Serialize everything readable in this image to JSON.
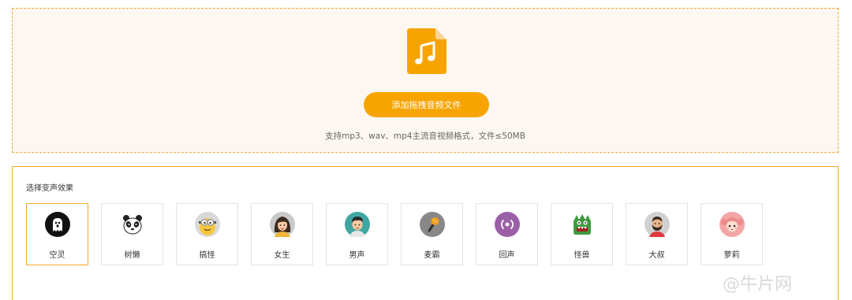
{
  "upload": {
    "button_label": "添加拖拽音频文件",
    "hint": "支持mp3、wav、mp4主流音视频格式，文件≤50MB",
    "icon": "music-file-icon",
    "accent_color": "#f7a400"
  },
  "effects": {
    "title": "选择变声效果",
    "selected_index": 0,
    "items": [
      {
        "label": "空灵",
        "icon": "ghost-icon"
      },
      {
        "label": "树懒",
        "icon": "panda-icon"
      },
      {
        "label": "搞怪",
        "icon": "minion-icon"
      },
      {
        "label": "女生",
        "icon": "girl-avatar-icon"
      },
      {
        "label": "男声",
        "icon": "boy-avatar-icon"
      },
      {
        "label": "麦霸",
        "icon": "microphone-icon"
      },
      {
        "label": "回声",
        "icon": "echo-icon"
      },
      {
        "label": "怪兽",
        "icon": "monster-icon"
      },
      {
        "label": "大叔",
        "icon": "bearded-man-icon"
      },
      {
        "label": "萝莉",
        "icon": "loli-avatar-icon"
      }
    ]
  },
  "watermark": "@牛片网"
}
